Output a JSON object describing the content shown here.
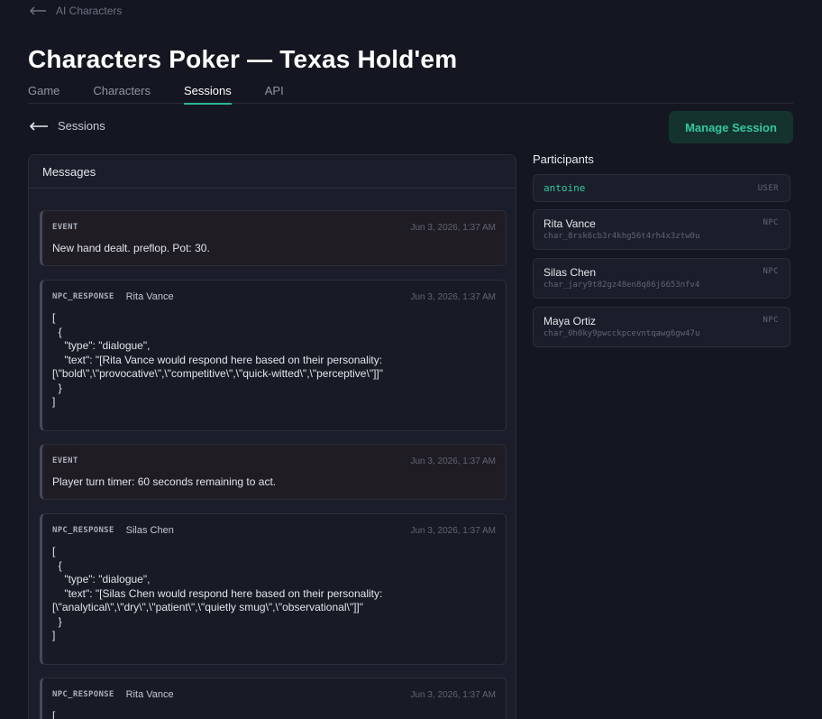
{
  "breadcrumb": {
    "label": "AI Characters"
  },
  "page": {
    "title": "Characters Poker — Texas Hold'em"
  },
  "tabs": [
    {
      "label": "Game",
      "active": false
    },
    {
      "label": "Characters",
      "active": false
    },
    {
      "label": "Sessions",
      "active": true
    },
    {
      "label": "API",
      "active": false
    }
  ],
  "back": {
    "label": "Sessions"
  },
  "actions": {
    "manage_label": "Manage Session"
  },
  "messages": {
    "title": "Messages",
    "items": [
      {
        "type": "EVENT",
        "who": "",
        "time": "Jun 3, 2026, 1:37 AM",
        "body": "New hand dealt. preflop. Pot: 30."
      },
      {
        "type": "NPC_RESPONSE",
        "who": "Rita Vance",
        "time": "Jun 3, 2026, 1:37 AM",
        "body": "[\n  {\n    \"type\": \"dialogue\",\n    \"text\": \"[Rita Vance would respond here based on their personality:\n[\\\"bold\\\",\\\"provocative\\\",\\\"competitive\\\",\\\"quick-witted\\\",\\\"perceptive\\\"]]\"\n  }\n]"
      },
      {
        "type": "EVENT",
        "who": "",
        "time": "Jun 3, 2026, 1:37 AM",
        "body": "Player turn timer: 60 seconds remaining to act."
      },
      {
        "type": "NPC_RESPONSE",
        "who": "Silas Chen",
        "time": "Jun 3, 2026, 1:37 AM",
        "body": "[\n  {\n    \"type\": \"dialogue\",\n    \"text\": \"[Silas Chen would respond here based on their personality:\n[\\\"analytical\\\",\\\"dry\\\",\\\"patient\\\",\\\"quietly smug\\\",\\\"observational\\\"]]\"\n  }\n]"
      },
      {
        "type": "NPC_RESPONSE",
        "who": "Rita Vance",
        "time": "Jun 3, 2026, 1:37 AM",
        "body": "["
      }
    ]
  },
  "participants": {
    "title": "Participants",
    "items": [
      {
        "name": "antoine",
        "id": "",
        "role": "USER"
      },
      {
        "name": "Rita Vance",
        "id": "char_8rsk6cb3r4khg56t4rh4x3ztw0u",
        "role": "NPC"
      },
      {
        "name": "Silas Chen",
        "id": "char_jary9t82gz48en8q86j6653nfv4",
        "role": "NPC"
      },
      {
        "name": "Maya Ortiz",
        "id": "char_0h0ky9pwcckpcevntqawg6gw47u",
        "role": "NPC"
      }
    ]
  },
  "colors": {
    "accent": "#2bb593",
    "background": "#141721",
    "panel": "#1b1e2a"
  },
  "icons": {
    "back": "arrow-left-icon"
  }
}
